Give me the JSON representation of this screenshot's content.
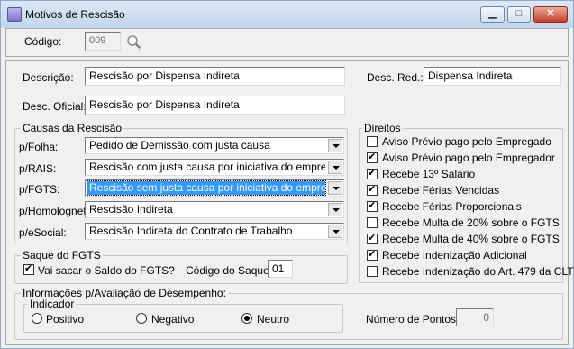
{
  "window": {
    "title": "Motivos de Rescisão"
  },
  "codigo": {
    "label": "Código:",
    "value": "009"
  },
  "descricao": {
    "label": "Descrição:",
    "value": "Rescisão por Dispensa Indireta"
  },
  "desc_red": {
    "label": "Desc. Red.:",
    "value": "Dispensa Indireta"
  },
  "desc_oficial": {
    "label": "Desc. Oficial:",
    "value": "Rescisão por Dispensa Indireta"
  },
  "causas": {
    "title": "Causas da Rescisão",
    "rows": [
      {
        "label": "p/Folha:",
        "value": "Pedido de Demissão com justa causa"
      },
      {
        "label": "p/RAIS:",
        "value": "Rescisão com justa causa por iniciativa do empregado"
      },
      {
        "label": "p/FGTS:",
        "value": "Rescisão sem justa causa por iniciativa do empregador"
      },
      {
        "label": "p/Homolognet:",
        "value": "Rescisão Indireta"
      },
      {
        "label": "p/eSocial:",
        "value": "Rescisão Indireta do Contrato de Trabalho"
      }
    ]
  },
  "direitos": {
    "title": "Direitos",
    "items": [
      {
        "label": "Aviso Prévio pago pelo Empregado",
        "checked": false
      },
      {
        "label": "Aviso Prévio pago pelo Empregador",
        "checked": true
      },
      {
        "label": "Recebe 13º Salário",
        "checked": true
      },
      {
        "label": "Recebe Férias Vencidas",
        "checked": true
      },
      {
        "label": "Recebe Férias Proporcionais",
        "checked": true
      },
      {
        "label": "Recebe Multa de 20% sobre o FGTS",
        "checked": false
      },
      {
        "label": "Recebe Multa de 40% sobre o FGTS",
        "checked": true
      },
      {
        "label": "Recebe Indenização Adicional",
        "checked": true
      },
      {
        "label": "Recebe Indenização do Art. 479 da CLT",
        "checked": false
      }
    ]
  },
  "saque": {
    "title": "Saque do FGTS",
    "checkbox_label": "Vai sacar o Saldo do FGTS?",
    "checked": true,
    "codigo_label": "Código do Saque:",
    "codigo_value": "01"
  },
  "avaliacao": {
    "title": "Informações p/Avaliação de Desempenho:",
    "indicador_title": "Indicador",
    "options": [
      "Positivo",
      "Negativo",
      "Neutro"
    ],
    "selected": "Neutro",
    "pontos_label": "Número de Pontos :",
    "pontos_value": "0"
  }
}
